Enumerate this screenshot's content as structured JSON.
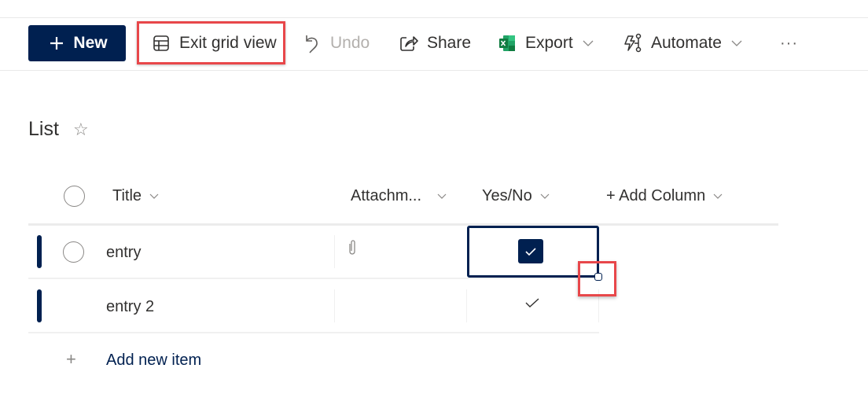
{
  "toolbar": {
    "new_label": "New",
    "exit_grid_label": "Exit grid view",
    "undo_label": "Undo",
    "share_label": "Share",
    "export_label": "Export",
    "automate_label": "Automate",
    "more_label": "···",
    "accent_color": "#002050",
    "highlight_color": "#e8474a",
    "undo_enabled": false
  },
  "list": {
    "title": "List",
    "favorite": false
  },
  "columns": [
    {
      "label": "Title",
      "has_menu": true
    },
    {
      "label": "Attachm...",
      "has_menu": true
    },
    {
      "label": "Yes/No",
      "has_menu": true
    },
    {
      "label": "+ Add Column",
      "has_menu": true
    }
  ],
  "rows": [
    {
      "title": "entry",
      "has_attachment": true,
      "yes_no": true,
      "selected_cell": "Yes/No",
      "checkbox_visible": true
    },
    {
      "title": "entry 2",
      "has_attachment": false,
      "yes_no": true,
      "checkbox_visible": false
    }
  ],
  "add_item_label": "Add new item"
}
